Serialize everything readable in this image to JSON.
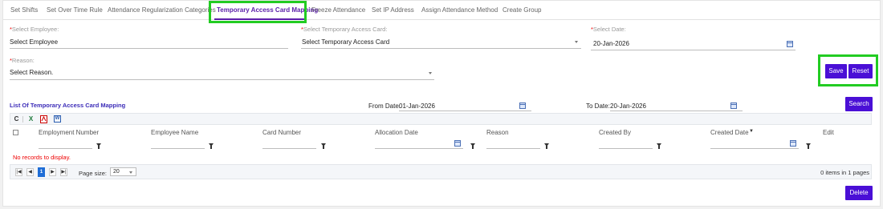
{
  "tabs": [
    {
      "label": "Set Shifts"
    },
    {
      "label": "Set Over Time Rule"
    },
    {
      "label": "Attendance Regularization Categories"
    },
    {
      "label": "Temporary Access Card Mapping"
    },
    {
      "label": "Freeze Attendance"
    },
    {
      "label": "Set IP Address"
    },
    {
      "label": "Assign Attendance Method"
    },
    {
      "label": "Create Group"
    }
  ],
  "active_tab_index": 3,
  "form": {
    "required_mark": "*",
    "employee": {
      "label": "Select Employee:",
      "value": "Select Employee"
    },
    "card": {
      "label": "Select Temporary Access Card:",
      "value": "Select Temporary Access Card"
    },
    "date": {
      "label": "Select Date:",
      "value": "20-Jan-2026"
    },
    "reason": {
      "label": "Reason:",
      "value": "Select Reason."
    },
    "save_label": "Save",
    "reset_label": "Reset"
  },
  "list": {
    "title": "List Of Temporary Access Card Mapping",
    "from_date_label": "From Date:",
    "from_date_value": "01-Jan-2026",
    "to_date_label": "To Date:",
    "to_date_value": "20-Jan-2026",
    "search_label": "Search"
  },
  "toolbar": {
    "refresh_glyph": "C",
    "excel_glyph": "X",
    "word_glyph": "W"
  },
  "grid": {
    "columns": [
      {
        "label": "Employment Number"
      },
      {
        "label": "Employee Name"
      },
      {
        "label": "Card Number"
      },
      {
        "label": "Allocation Date"
      },
      {
        "label": "Reason"
      },
      {
        "label": "Created By"
      },
      {
        "label": "Created Date"
      },
      {
        "label": "Edit"
      }
    ],
    "sort_glyph": "▼",
    "empty_message": "No records to display."
  },
  "pager": {
    "current_page": "1",
    "page_size_label": "Page size:",
    "page_size_value": "20",
    "summary": "0 items in 1 pages"
  },
  "delete_label": "Delete",
  "colors": {
    "accent": "#4a0fd6",
    "tab_active": "#5a1ea8",
    "highlight": "#22cc22",
    "error": "#e00000"
  }
}
